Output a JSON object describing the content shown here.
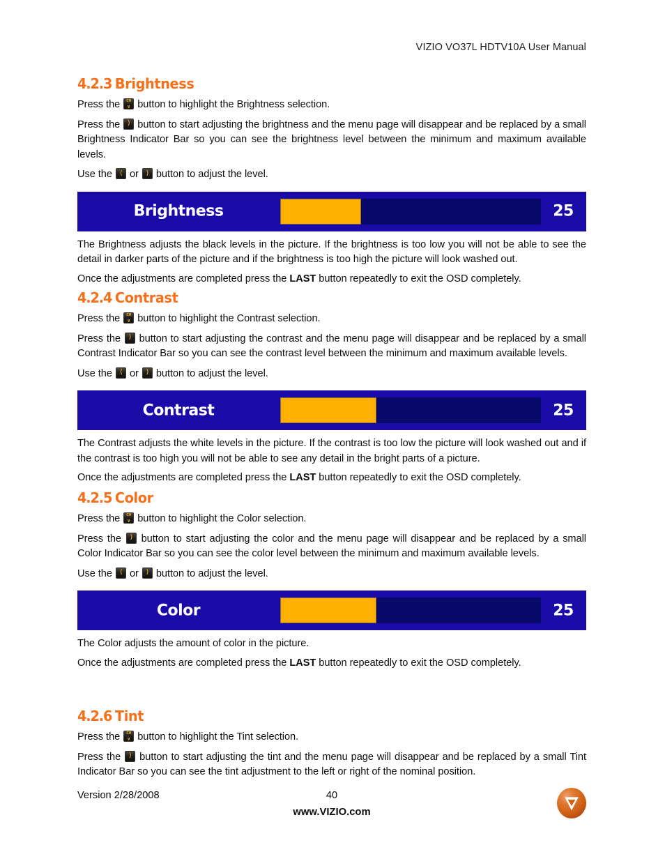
{
  "document": {
    "header": "VIZIO VO37L HDTV10A User Manual",
    "page_number": "40",
    "version": "Version 2/28/2008",
    "website": "www.VIZIO.com",
    "logo_letter": "V",
    "heading_color": "#f4701b",
    "osd_background_color": "#1a0aa8",
    "osd_fill_color": "#ffb000",
    "osd_track_color": "#080868"
  },
  "icons": {
    "ch_down": {
      "line1": "CH",
      "line2": "∨",
      "name": "ch-down-button-icon"
    },
    "right": {
      "glyph": "⟩",
      "name": "right-arrow-button-icon"
    },
    "left": {
      "glyph": "⟨",
      "name": "left-arrow-button-icon"
    }
  },
  "sections": [
    {
      "number": "4.2.3",
      "title": "Brightness",
      "p1_before": "Press the ",
      "p1_after": " button to highlight the Brightness selection.",
      "p2_before": "Press the ",
      "p2_after": " button to start adjusting the brightness and the menu page will disappear and be replaced by a small Brightness Indicator Bar so you can see the brightness level between the minimum and maximum available levels.",
      "p3_before": "Use the ",
      "p3_middle": " or ",
      "p3_after": " button to adjust the level.",
      "osd": {
        "label": "Brightness",
        "value": "25",
        "fill_percent": 31
      },
      "desc": "The Brightness adjusts the black levels in the picture.  If the brightness is too low you will not be able to see the detail in darker parts of the picture and if the brightness is too high the picture will look washed out.",
      "exit_before": "Once the adjustments are completed press the ",
      "exit_bold": "LAST",
      "exit_after": " button repeatedly to exit the OSD completely."
    },
    {
      "number": "4.2.4",
      "title": "Contrast",
      "p1_before": "Press the ",
      "p1_after": " button to highlight the Contrast selection.",
      "p2_before": "Press the ",
      "p2_after": " button to start adjusting the contrast and the menu page will disappear and be replaced by a small Contrast Indicator Bar so you can see the contrast level between the minimum and maximum available levels.",
      "p3_before": "Use the ",
      "p3_middle": " or ",
      "p3_after": " button to adjust the level.",
      "osd": {
        "label": "Contrast",
        "value": "25",
        "fill_percent": 37
      },
      "desc": "The Contrast adjusts the white levels in the picture.  If the contrast is too low the picture will look washed out and if the contrast is too high you will not be able to see any detail in the bright parts of a picture.",
      "exit_before": "Once the adjustments are completed press the ",
      "exit_bold": "LAST",
      "exit_after": " button repeatedly to exit the OSD completely."
    },
    {
      "number": "4.2.5",
      "title": "Color",
      "p1_before": "Press the ",
      "p1_after": " button to highlight the Color selection.",
      "p2_before": "Press the ",
      "p2_after": " button to start adjusting the color and the menu page will disappear and be replaced by a small Color Indicator Bar so you can see the color level between the minimum and maximum available levels.",
      "p3_before": "Use the ",
      "p3_middle": " or ",
      "p3_after": " button to adjust the level.",
      "osd": {
        "label": "Color",
        "value": "25",
        "fill_percent": 37
      },
      "desc": "The Color adjusts the amount of color in the picture.",
      "exit_before": "Once the adjustments are completed press the ",
      "exit_bold": "LAST",
      "exit_after": " button repeatedly to exit the OSD completely."
    },
    {
      "number": "4.2.6",
      "title": "Tint",
      "p1_before": "Press the ",
      "p1_after": " button to highlight the Tint selection.",
      "p2_before": "Press the ",
      "p2_after": " button to start adjusting the tint and the menu page will disappear and be replaced by a small Tint Indicator Bar so you can see the tint adjustment to the left or right of the nominal position."
    }
  ]
}
